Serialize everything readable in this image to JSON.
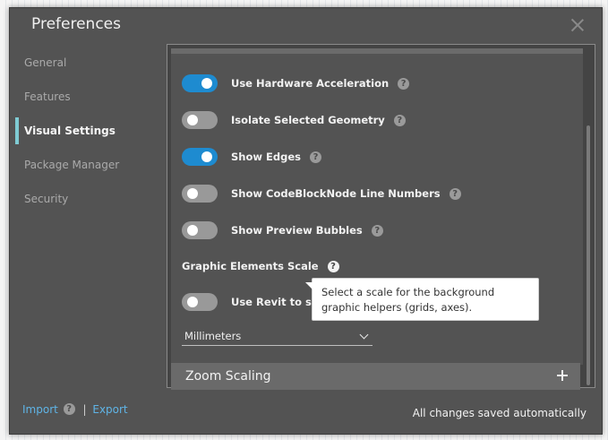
{
  "dialog": {
    "title": "Preferences",
    "close_icon": "close-icon"
  },
  "nav": {
    "items": [
      {
        "label": "General",
        "active": false
      },
      {
        "label": "Features",
        "active": false
      },
      {
        "label": "Visual Settings",
        "active": true
      },
      {
        "label": "Package Manager",
        "active": false
      },
      {
        "label": "Security",
        "active": false
      }
    ]
  },
  "visual_settings": {
    "toggles": [
      {
        "label": "Use Hardware Acceleration",
        "on": true
      },
      {
        "label": "Isolate Selected Geometry",
        "on": false
      },
      {
        "label": "Show Edges",
        "on": true
      },
      {
        "label": "Show CodeBlockNode Line Numbers",
        "on": false
      },
      {
        "label": "Show Preview Bubbles",
        "on": false
      }
    ],
    "graphic_scale_heading": "Graphic Elements Scale",
    "revit_toggle": {
      "label": "Use Revit to scal",
      "on": false
    },
    "units_select": {
      "value": "Millimeters"
    },
    "tooltip": "Select a scale for the background graphic helpers (grids, axes).",
    "zoom_section": "Zoom Scaling",
    "help_glyph": "?"
  },
  "footer": {
    "import_label": "Import",
    "separator": "|",
    "export_label": "Export",
    "status": "All changes saved automatically"
  },
  "colors": {
    "accent": "#1e8bd0",
    "active_marker": "#7fcbd3",
    "link": "#5fb4e6"
  }
}
